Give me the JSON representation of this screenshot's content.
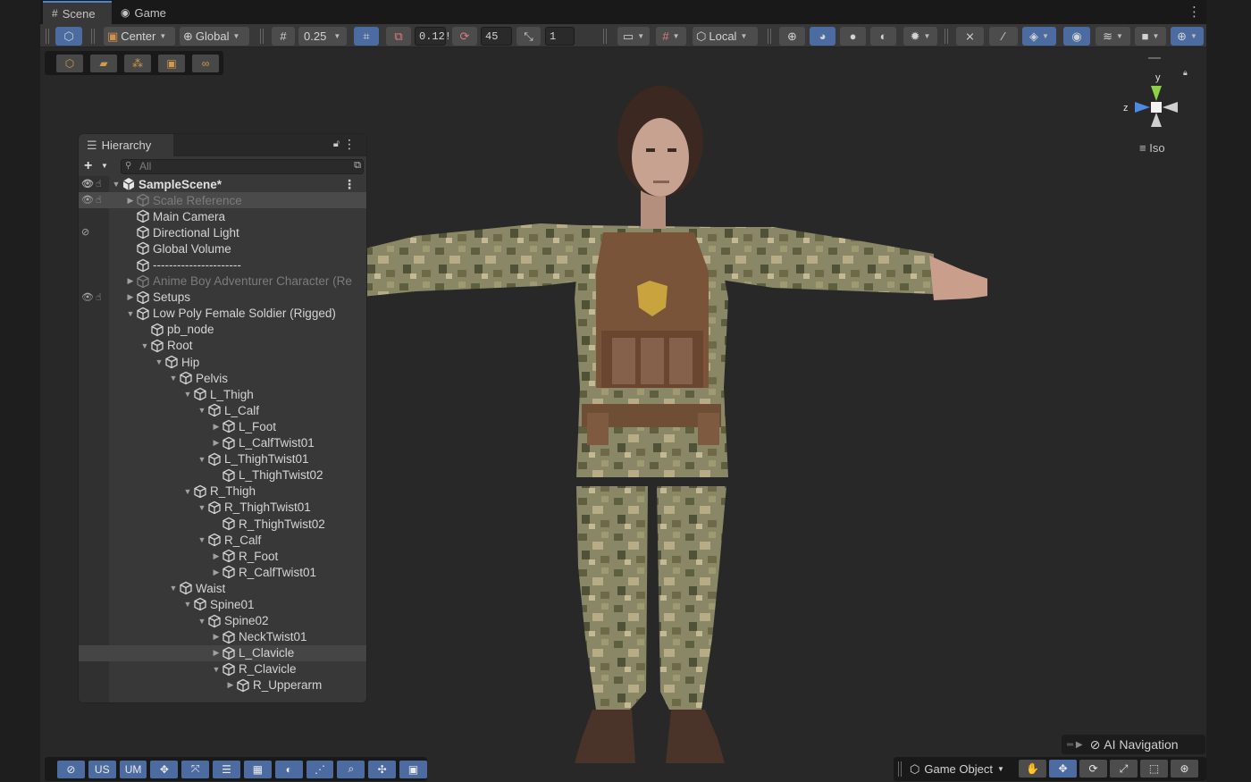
{
  "tabs": [
    {
      "label": "Scene",
      "icon": "grid-icon",
      "active": true
    },
    {
      "label": "Game",
      "icon": "gamepad-icon",
      "active": false
    }
  ],
  "toolbar": {
    "pivot_mode": "Center",
    "pivot_rotation": "Global",
    "grid_snap_value": "0.25",
    "move_snap_value": "0.12!",
    "rotate_snap_value": "45",
    "scale_snap_value": "1",
    "space_mode": "Local"
  },
  "gizmo": {
    "y_label": "y",
    "z_label": "z",
    "projection": "Iso"
  },
  "hierarchy": {
    "title": "Hierarchy",
    "search_placeholder": "All",
    "items": [
      {
        "label": "SampleScene*",
        "depth": 0,
        "expand": "open",
        "kind": "scene"
      },
      {
        "label": "Scale Reference",
        "depth": 1,
        "expand": "closed",
        "dim": true,
        "selected": true
      },
      {
        "label": "Main Camera",
        "depth": 1,
        "expand": "none"
      },
      {
        "label": "Directional Light",
        "depth": 1,
        "expand": "none",
        "hidden": true
      },
      {
        "label": "Global Volume",
        "depth": 1,
        "expand": "none"
      },
      {
        "label": "----------------------",
        "depth": 1,
        "expand": "none"
      },
      {
        "label": "Anime Boy Adventurer Character (Re",
        "depth": 1,
        "expand": "closed",
        "dim": true
      },
      {
        "label": "Setups",
        "depth": 1,
        "expand": "closed"
      },
      {
        "label": "Low Poly Female Soldier (Rigged)",
        "depth": 1,
        "expand": "open"
      },
      {
        "label": "pb_node",
        "depth": 2,
        "expand": "none"
      },
      {
        "label": "Root",
        "depth": 2,
        "expand": "open"
      },
      {
        "label": "Hip",
        "depth": 3,
        "expand": "open"
      },
      {
        "label": "Pelvis",
        "depth": 4,
        "expand": "open"
      },
      {
        "label": "L_Thigh",
        "depth": 5,
        "expand": "open"
      },
      {
        "label": "L_Calf",
        "depth": 6,
        "expand": "open"
      },
      {
        "label": "L_Foot",
        "depth": 7,
        "expand": "closed"
      },
      {
        "label": "L_CalfTwist01",
        "depth": 7,
        "expand": "closed"
      },
      {
        "label": "L_ThighTwist01",
        "depth": 6,
        "expand": "open"
      },
      {
        "label": "L_ThighTwist02",
        "depth": 7,
        "expand": "none"
      },
      {
        "label": "R_Thigh",
        "depth": 5,
        "expand": "open"
      },
      {
        "label": "R_ThighTwist01",
        "depth": 6,
        "expand": "open"
      },
      {
        "label": "R_ThighTwist02",
        "depth": 7,
        "expand": "none"
      },
      {
        "label": "R_Calf",
        "depth": 6,
        "expand": "open"
      },
      {
        "label": "R_Foot",
        "depth": 7,
        "expand": "closed"
      },
      {
        "label": "R_CalfTwist01",
        "depth": 7,
        "expand": "closed"
      },
      {
        "label": "Waist",
        "depth": 4,
        "expand": "open"
      },
      {
        "label": "Spine01",
        "depth": 5,
        "expand": "open"
      },
      {
        "label": "Spine02",
        "depth": 6,
        "expand": "open"
      },
      {
        "label": "NeckTwist01",
        "depth": 7,
        "expand": "closed"
      },
      {
        "label": "L_Clavicle",
        "depth": 7,
        "expand": "closed",
        "highlighted": true
      },
      {
        "label": "R_Clavicle",
        "depth": 7,
        "expand": "open"
      },
      {
        "label": "R_Upperarm",
        "depth": 8,
        "expand": "closed"
      }
    ]
  },
  "bottom_left": {
    "us_label": "US",
    "um_label": "UM"
  },
  "overlays": {
    "ai_navigation": "AI Navigation",
    "game_object": "Game Object"
  },
  "colors": {
    "accent": "#4c6ba0",
    "panel": "#383838",
    "toolbar": "#383838",
    "viewport": "#282828"
  }
}
